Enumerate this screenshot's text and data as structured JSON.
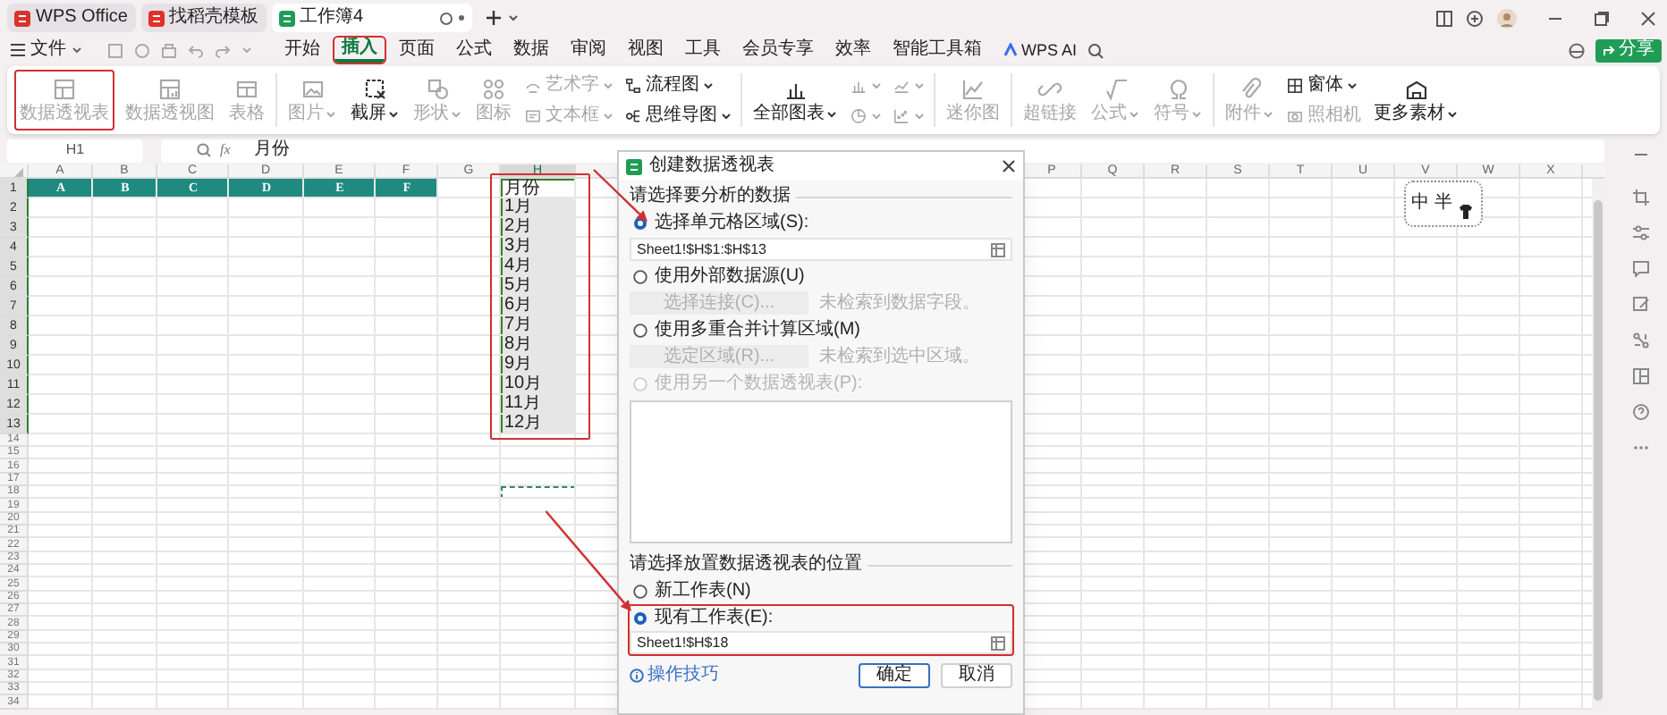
{
  "title_bar": {
    "tabs": [
      {
        "label": "WPS Office",
        "kind": "home",
        "selected": false
      },
      {
        "label": "找稻壳模板",
        "kind": "template",
        "selected": false
      },
      {
        "label": "工作簿4",
        "kind": "sheet",
        "selected": true
      }
    ]
  },
  "menu_bar": {
    "file": "文件",
    "tabs": [
      {
        "label": "开始",
        "selected": false,
        "highlighted": false
      },
      {
        "label": "插入",
        "selected": true,
        "highlighted": true
      },
      {
        "label": "页面",
        "selected": false,
        "highlighted": false
      },
      {
        "label": "公式",
        "selected": false,
        "highlighted": false
      },
      {
        "label": "数据",
        "selected": false,
        "highlighted": false
      },
      {
        "label": "审阅",
        "selected": false,
        "highlighted": false
      },
      {
        "label": "视图",
        "selected": false,
        "highlighted": false
      },
      {
        "label": "工具",
        "selected": false,
        "highlighted": false
      },
      {
        "label": "会员专享",
        "selected": false,
        "highlighted": false
      },
      {
        "label": "效率",
        "selected": false,
        "highlighted": false
      },
      {
        "label": "智能工具箱",
        "selected": false,
        "highlighted": false
      }
    ],
    "ai": "WPS AI",
    "share": "分享"
  },
  "ribbon": {
    "groups": [
      {
        "columns": [
          {
            "stacked": false,
            "items": [
              {
                "label": "数据透视表",
                "kind": "pivot",
                "dropdown": false,
                "disabled": true,
                "highlighted": true
              }
            ]
          },
          {
            "stacked": false,
            "items": [
              {
                "label": "数据透视图",
                "kind": "pivotchart",
                "dropdown": false,
                "disabled": true,
                "highlighted": false
              }
            ]
          },
          {
            "stacked": false,
            "items": [
              {
                "label": "表格",
                "kind": "table",
                "dropdown": false,
                "disabled": true,
                "highlighted": false
              }
            ]
          }
        ]
      },
      {
        "columns": [
          {
            "stacked": false,
            "items": [
              {
                "label": "图片",
                "kind": "picture",
                "dropdown": true,
                "disabled": true,
                "highlighted": false
              }
            ]
          },
          {
            "stacked": false,
            "items": [
              {
                "label": "截屏",
                "kind": "screenshot",
                "dropdown": true,
                "disabled": false,
                "highlighted": false
              }
            ]
          },
          {
            "stacked": false,
            "items": [
              {
                "label": "形状",
                "kind": "shape",
                "dropdown": true,
                "disabled": true,
                "highlighted": false
              }
            ]
          },
          {
            "stacked": false,
            "items": [
              {
                "label": "图标",
                "kind": "icons",
                "dropdown": false,
                "disabled": true,
                "highlighted": false
              }
            ]
          },
          {
            "stacked": true,
            "items": [
              {
                "label": "艺术字",
                "kind": "wordart",
                "dropdown": true,
                "disabled": true,
                "highlighted": false
              },
              {
                "label": "文本框",
                "kind": "textbox",
                "dropdown": true,
                "disabled": true,
                "highlighted": false
              }
            ]
          },
          {
            "stacked": true,
            "items": [
              {
                "label": "流程图",
                "kind": "flow",
                "dropdown": true,
                "disabled": false,
                "highlighted": false
              },
              {
                "label": "思维导图",
                "kind": "mindmap",
                "dropdown": true,
                "disabled": false,
                "highlighted": false
              }
            ]
          }
        ]
      },
      {
        "columns": [
          {
            "stacked": false,
            "items": [
              {
                "label": "全部图表",
                "kind": "chart",
                "dropdown": true,
                "disabled": false,
                "highlighted": false
              }
            ]
          },
          {
            "stacked": true,
            "items": [
              {
                "kind": "colchart",
                "dropdown": true,
                "disabled": true,
                "highlighted": false
              },
              {
                "kind": "pie",
                "dropdown": true,
                "disabled": true,
                "highlighted": false
              }
            ]
          },
          {
            "stacked": true,
            "items": [
              {
                "kind": "line",
                "dropdown": true,
                "disabled": true,
                "highlighted": false
              },
              {
                "kind": "scatter",
                "dropdown": true,
                "disabled": true,
                "highlighted": false
              }
            ]
          }
        ]
      },
      {
        "columns": [
          {
            "stacked": false,
            "items": [
              {
                "label": "迷你图",
                "kind": "sparkline",
                "dropdown": false,
                "disabled": true,
                "highlighted": false
              }
            ]
          }
        ]
      },
      {
        "columns": [
          {
            "stacked": false,
            "items": [
              {
                "label": "超链接",
                "kind": "link",
                "dropdown": false,
                "disabled": true,
                "highlighted": false
              }
            ]
          },
          {
            "stacked": false,
            "items": [
              {
                "label": "公式",
                "kind": "formula",
                "dropdown": true,
                "disabled": true,
                "highlighted": false
              }
            ]
          },
          {
            "stacked": false,
            "items": [
              {
                "label": "符号",
                "kind": "symbol",
                "dropdown": true,
                "disabled": true,
                "highlighted": false
              }
            ]
          }
        ]
      },
      {
        "columns": [
          {
            "stacked": false,
            "items": [
              {
                "label": "附件",
                "kind": "attach",
                "dropdown": true,
                "disabled": true,
                "highlighted": false
              }
            ]
          },
          {
            "stacked": true,
            "items": [
              {
                "label": "窗体",
                "kind": "form",
                "dropdown": true,
                "disabled": false,
                "highlighted": false
              },
              {
                "label": "照相机",
                "kind": "camera",
                "dropdown": false,
                "disabled": true,
                "highlighted": false
              }
            ]
          },
          {
            "stacked": false,
            "items": [
              {
                "label": "更多素材",
                "kind": "materials",
                "dropdown": true,
                "disabled": false,
                "highlighted": false
              }
            ]
          }
        ]
      }
    ]
  },
  "formula_bar": {
    "name_box": "H1",
    "fx": "fx",
    "formula": "月份"
  },
  "sheet": {
    "columns_left": [
      {
        "label": "A",
        "selected": false
      },
      {
        "label": "B",
        "selected": false
      },
      {
        "label": "C",
        "selected": false
      },
      {
        "label": "D",
        "selected": false
      },
      {
        "label": "E",
        "selected": false
      },
      {
        "label": "F",
        "selected": false
      },
      {
        "label": "G",
        "selected": false
      },
      {
        "label": "H",
        "selected": true
      }
    ],
    "columns_right": [
      {
        "label": "P",
        "selected": false
      },
      {
        "label": "Q",
        "selected": false
      },
      {
        "label": "R",
        "selected": false
      },
      {
        "label": "S",
        "selected": false
      },
      {
        "label": "T",
        "selected": false
      },
      {
        "label": "U",
        "selected": false
      },
      {
        "label": "V",
        "selected": false
      },
      {
        "label": "W",
        "selected": false
      },
      {
        "label": "X",
        "selected": false
      }
    ],
    "rows": [
      {
        "label": "1",
        "selected": true
      },
      {
        "label": "2",
        "selected": true
      },
      {
        "label": "3",
        "selected": true
      },
      {
        "label": "4",
        "selected": true
      },
      {
        "label": "5",
        "selected": true
      },
      {
        "label": "6",
        "selected": true
      },
      {
        "label": "7",
        "selected": true
      },
      {
        "label": "8",
        "selected": true
      },
      {
        "label": "9",
        "selected": true
      },
      {
        "label": "10",
        "selected": true
      },
      {
        "label": "11",
        "selected": true
      },
      {
        "label": "12",
        "selected": true
      },
      {
        "label": "13",
        "selected": true
      },
      {
        "label": "14",
        "selected": false
      },
      {
        "label": "15",
        "selected": false
      },
      {
        "label": "16",
        "selected": false
      },
      {
        "label": "17",
        "selected": false
      },
      {
        "label": "18",
        "selected": false
      },
      {
        "label": "19",
        "selected": false
      },
      {
        "label": "20",
        "selected": false
      },
      {
        "label": "21",
        "selected": false
      },
      {
        "label": "22",
        "selected": false
      },
      {
        "label": "23",
        "selected": false
      },
      {
        "label": "24",
        "selected": false
      },
      {
        "label": "25",
        "selected": false
      },
      {
        "label": "26",
        "selected": false
      },
      {
        "label": "27",
        "selected": false
      },
      {
        "label": "28",
        "selected": false
      },
      {
        "label": "29",
        "selected": false
      },
      {
        "label": "30",
        "selected": false
      },
      {
        "label": "31",
        "selected": false
      },
      {
        "label": "32",
        "selected": false
      },
      {
        "label": "33",
        "selected": false
      },
      {
        "label": "34",
        "selected": false
      }
    ],
    "header_band": [
      "A",
      "B",
      "C",
      "D",
      "E",
      "F"
    ],
    "month_list": {
      "cells": [
        "月份",
        "1月",
        "2月",
        "3月",
        "4月",
        "5月",
        "6月",
        "7月",
        "8月",
        "9月",
        "10月",
        "11月",
        "12月"
      ],
      "highlighted": true
    }
  },
  "ime_toolbar": {
    "items": [
      "中",
      "半"
    ]
  },
  "dialog": {
    "title": "创建数据透视表",
    "source_section": "请选择要分析的数据",
    "source_options": [
      {
        "label": "选择单元格区域(S):",
        "kind": "range",
        "selected": true,
        "disabled": false,
        "value": "Sheet1!$H$1:$H$13"
      },
      {
        "label": "使用外部数据源(U)",
        "kind": "button",
        "selected": false,
        "disabled": false,
        "button": {
          "label": "选择连接(C)...",
          "disabled": true
        },
        "note": "未检索到数据字段。"
      },
      {
        "label": "使用多重合并计算区域(M)",
        "kind": "button",
        "selected": false,
        "disabled": false,
        "button": {
          "label": "选定区域(R)...",
          "disabled": true
        },
        "note": "未检索到选中区域。"
      },
      {
        "label": "使用另一个数据透视表(P):",
        "kind": "list",
        "selected": false,
        "disabled": true
      }
    ],
    "place_section": "请选择放置数据透视表的位置",
    "place_options": [
      {
        "label": "新工作表(N)",
        "selected": false,
        "highlighted": false
      },
      {
        "label": "现有工作表(E):",
        "selected": true,
        "highlighted": true,
        "value": "Sheet1!$H$18"
      }
    ],
    "tips": "操作技巧",
    "buttons": [
      {
        "label": "确定",
        "primary": true
      },
      {
        "label": "取消",
        "primary": false
      }
    ]
  }
}
